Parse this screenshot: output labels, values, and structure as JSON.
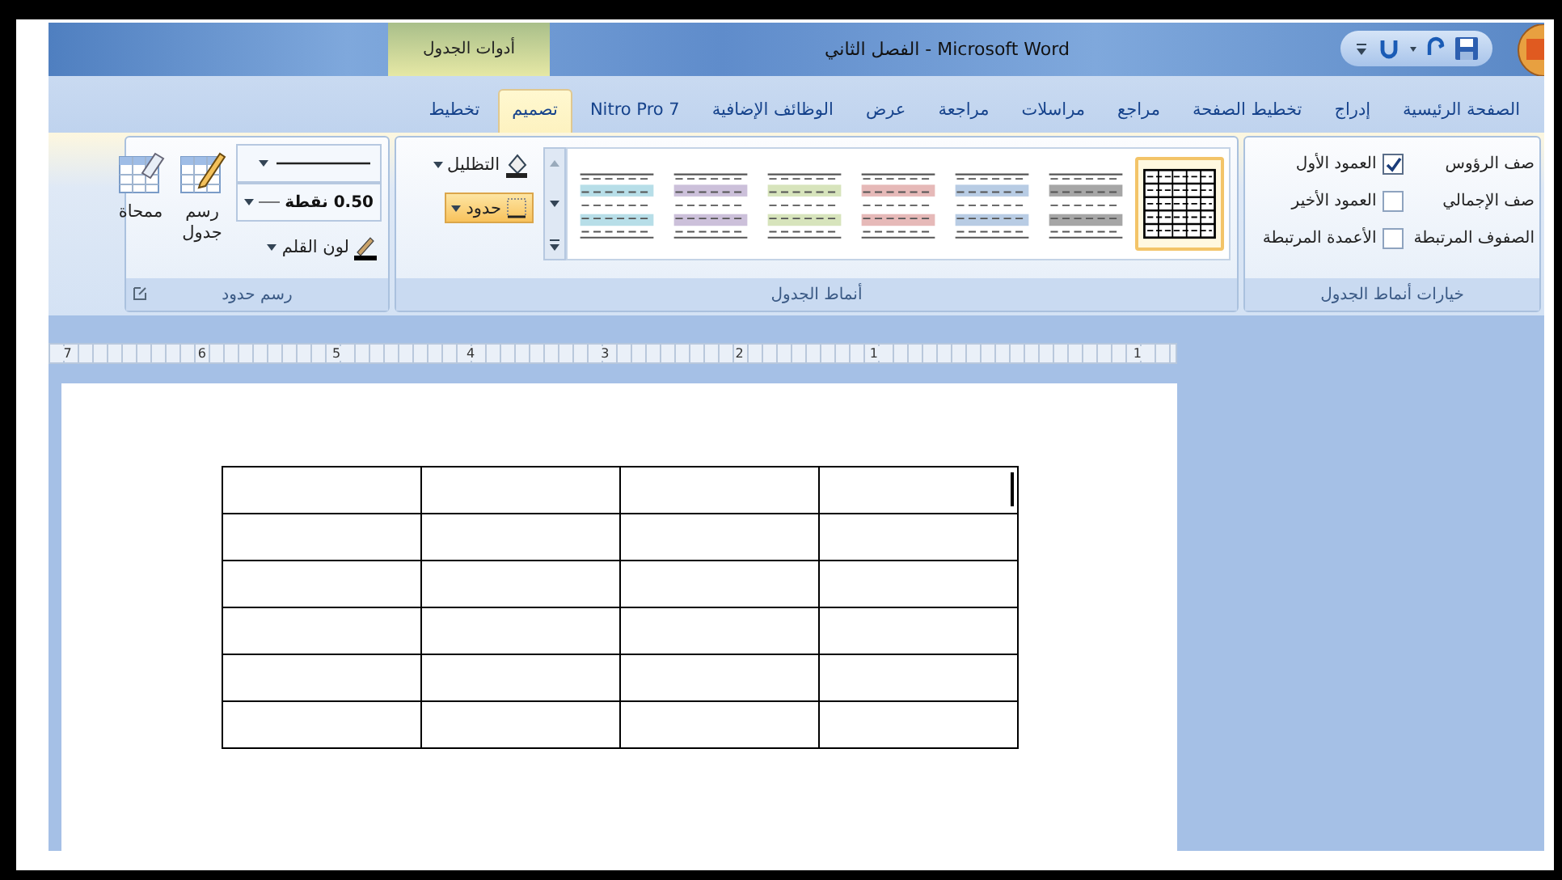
{
  "window": {
    "title": "الفصل الثاني - Microsoft Word",
    "context_group": "أدوات الجدول"
  },
  "tabs": [
    {
      "label": "الصفحة الرئيسية",
      "selected": false
    },
    {
      "label": "إدراج",
      "selected": false
    },
    {
      "label": "تخطيط الصفحة",
      "selected": false
    },
    {
      "label": "مراجع",
      "selected": false
    },
    {
      "label": "مراسلات",
      "selected": false
    },
    {
      "label": "مراجعة",
      "selected": false
    },
    {
      "label": "عرض",
      "selected": false
    },
    {
      "label": "الوظائف الإضافية",
      "selected": false
    },
    {
      "label": "Nitro Pro 7",
      "selected": false
    },
    {
      "label": "تصميم",
      "selected": true
    },
    {
      "label": "تخطيط",
      "selected": false
    }
  ],
  "style_options": {
    "label": "خيارات أنماط الجدول",
    "row_options": [
      "صف الرؤوس",
      "صف الإجمالي",
      "الصفوف المرتبطة"
    ],
    "column_options": [
      {
        "label": "العمود الأول",
        "checked": true
      },
      {
        "label": "العمود الأخير",
        "checked": false
      },
      {
        "label": "الأعمدة المرتبطة",
        "checked": false
      }
    ]
  },
  "table_styles": {
    "label": "أنماط الجدول",
    "shading": "التظليل",
    "borders": "حدود",
    "styles": [
      {
        "kind": "grid",
        "selected": true
      },
      {
        "kind": "banded",
        "color": "#a6a6a6",
        "selected": false
      },
      {
        "kind": "banded",
        "color": "#b8cce4",
        "selected": false
      },
      {
        "kind": "banded",
        "color": "#e6b9b8",
        "selected": false
      },
      {
        "kind": "banded",
        "color": "#d7e4bc",
        "selected": false
      },
      {
        "kind": "banded",
        "color": "#ccc0da",
        "selected": false
      },
      {
        "kind": "banded",
        "color": "#b7dee8",
        "selected": false
      }
    ]
  },
  "draw_borders": {
    "label": "رسم حدود",
    "pen_weight": "0.50 نقطة",
    "pen_color": "لون القلم",
    "draw_table": "رسم جدول",
    "eraser": "ممحاة"
  },
  "ruler": {
    "labels": [
      "1",
      "1",
      "2",
      "3",
      "4",
      "5",
      "6",
      "7"
    ]
  },
  "document": {
    "table": {
      "rows": [
        [
          {
            "caret": true
          },
          {
            "caret": false
          },
          {
            "caret": false
          },
          {
            "caret": false
          }
        ],
        [
          {
            "caret": false
          },
          {
            "caret": false
          },
          {
            "caret": false
          },
          {
            "caret": false
          }
        ],
        [
          {
            "caret": false
          },
          {
            "caret": false
          },
          {
            "caret": false
          },
          {
            "caret": false
          }
        ],
        [
          {
            "caret": false
          },
          {
            "caret": false
          },
          {
            "caret": false
          },
          {
            "caret": false
          }
        ],
        [
          {
            "caret": false
          },
          {
            "caret": false
          },
          {
            "caret": false
          },
          {
            "caret": false
          }
        ],
        [
          {
            "caret": false
          },
          {
            "caret": false
          },
          {
            "caret": false
          },
          {
            "caret": false
          }
        ]
      ]
    }
  }
}
